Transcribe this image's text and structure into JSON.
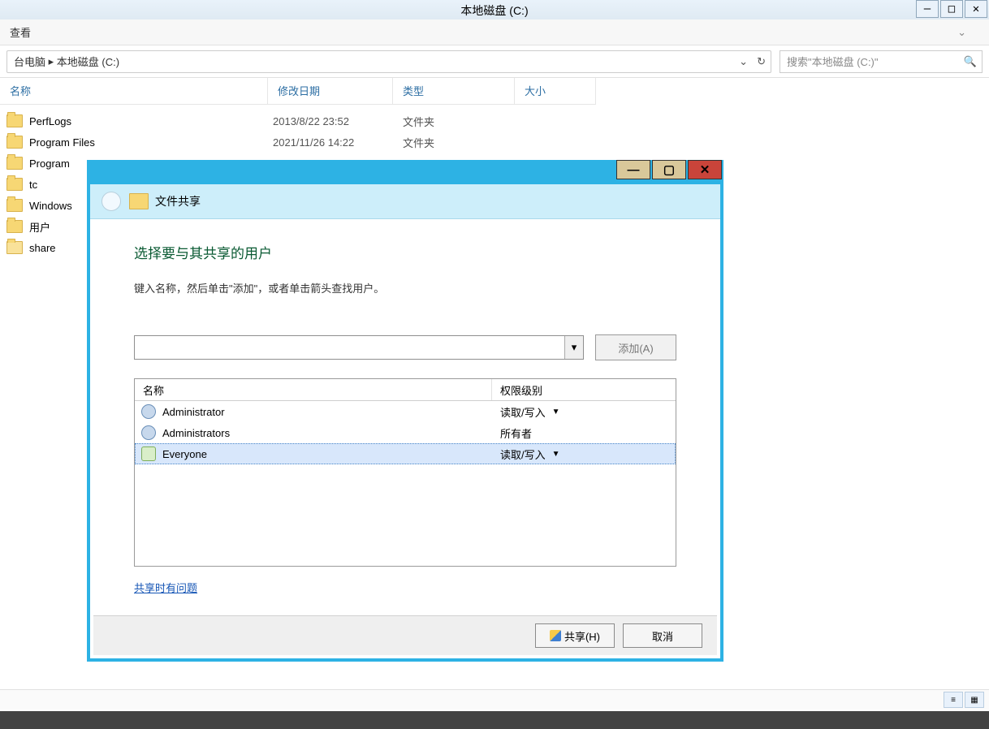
{
  "parentWindow": {
    "title": "本地磁盘 (C:)",
    "menubar": {
      "view": "查看"
    },
    "addressbar": {
      "crumb1": "台电脑",
      "sep": "▸",
      "crumb2": "本地磁盘 (C:)",
      "searchPlaceholder": "搜索\"本地磁盘 (C:)\""
    },
    "columns": {
      "name": "名称",
      "date": "修改日期",
      "type": "类型",
      "size": "大小"
    },
    "rows": [
      {
        "name": "PerfLogs",
        "date": "2013/8/22 23:52",
        "type": "文件夹"
      },
      {
        "name": "Program Files",
        "date": "2021/11/26 14:22",
        "type": "文件夹"
      },
      {
        "name": "Program",
        "date": "",
        "type": ""
      },
      {
        "name": "tc",
        "date": "",
        "type": ""
      },
      {
        "name": "Windows",
        "date": "",
        "type": ""
      },
      {
        "name": "用户",
        "date": "",
        "type": ""
      },
      {
        "name": "share",
        "date": "",
        "type": ""
      }
    ]
  },
  "dialog": {
    "title": "文件共享",
    "heading": "选择要与其共享的用户",
    "subtext": "键入名称，然后单击\"添加\"，或者单击箭头查找用户。",
    "addButton": "添加(A)",
    "columns": {
      "name": "名称",
      "perm": "权限级别"
    },
    "users": [
      {
        "name": "Administrator",
        "perm": "读取/写入",
        "hasDropdown": true,
        "iconType": "user"
      },
      {
        "name": "Administrators",
        "perm": "所有者",
        "hasDropdown": false,
        "iconType": "user"
      },
      {
        "name": "Everyone",
        "perm": "读取/写入",
        "hasDropdown": true,
        "iconType": "group"
      }
    ],
    "helplink": "共享时有问题",
    "buttons": {
      "share": "共享(H)",
      "cancel": "取消"
    }
  }
}
